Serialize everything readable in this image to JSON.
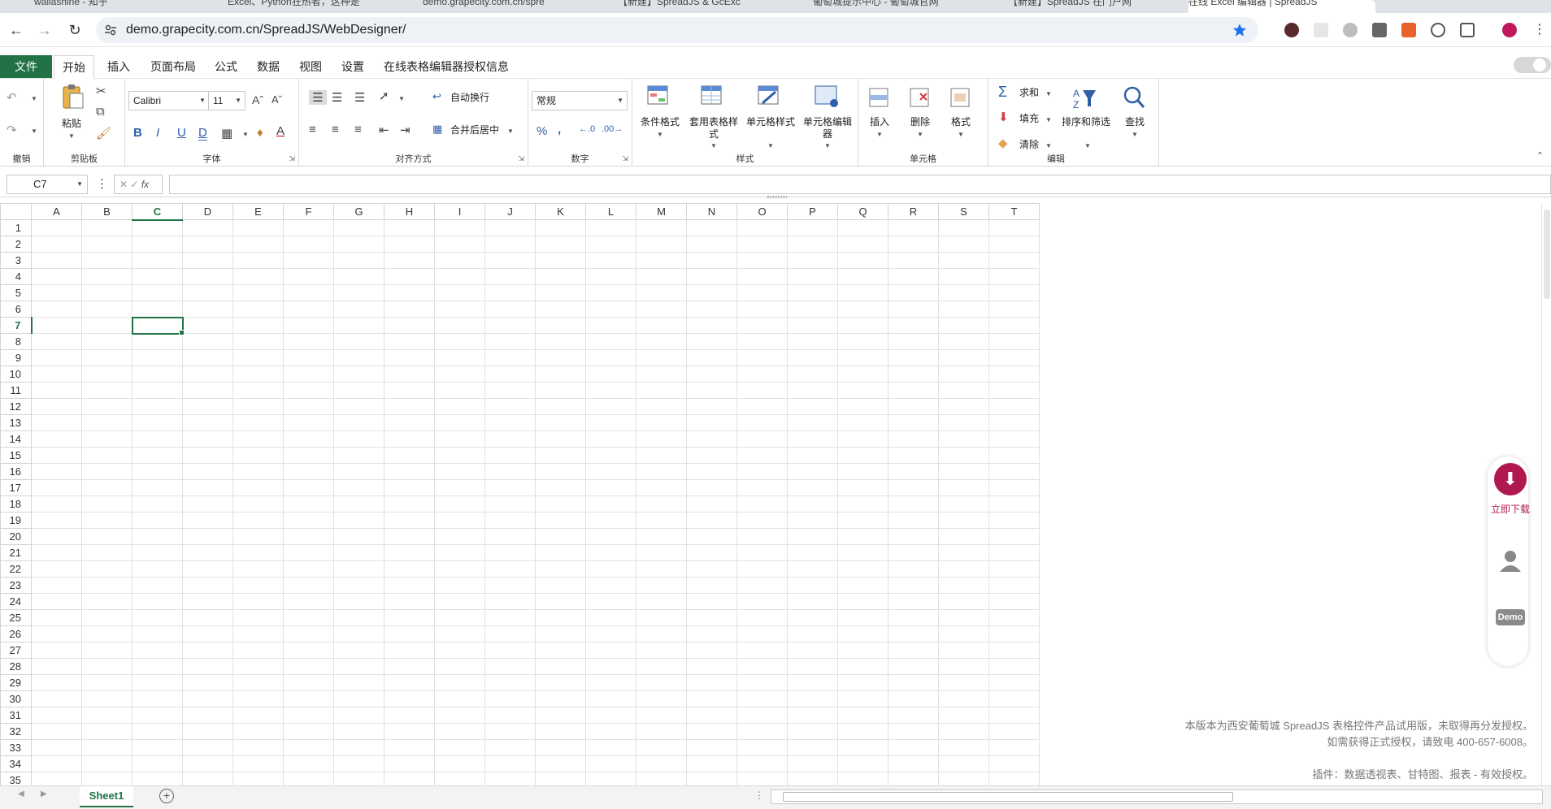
{
  "browser": {
    "tabs": [
      {
        "title": "wallashine - 知乎"
      },
      {
        "title": "Excel、Python狂热者，这种是"
      },
      {
        "title": "demo.grapecity.com.cn/spre"
      },
      {
        "title": "【新建】SpreadJS & GcExc"
      },
      {
        "title": "葡萄城提示中心 - 葡萄城官网"
      },
      {
        "title": "【新建】SpreadJS 在门户网"
      },
      {
        "title": "在线 Excel 编辑器 | SpreadJS"
      }
    ],
    "url": "demo.grapecity.com.cn/SpreadJS/WebDesigner/",
    "accent": "#1a73e8"
  },
  "menu": {
    "file": "文件",
    "tabs": [
      "开始",
      "插入",
      "页面布局",
      "公式",
      "数据",
      "视图",
      "设置",
      "在线表格编辑器授权信息"
    ],
    "active_index": 0
  },
  "ribbon": {
    "groups": {
      "undo": "撤销",
      "clipboard": "剪贴板",
      "font": "字体",
      "alignment": "对齐方式",
      "number": "数字",
      "styles": "样式",
      "cells": "单元格",
      "editing": "编辑"
    },
    "paste": "粘贴",
    "font_name": "Calibri",
    "font_size": "11",
    "wrap_text": "自动换行",
    "merge_center": "合并后居中",
    "number_format": "常规",
    "conditional_format": "条件格式",
    "table_style": "套用表格样式",
    "cell_style": "单元格样式",
    "cell_editor": "单元格编辑器",
    "insert": "插入",
    "delete": "删除",
    "format": "格式",
    "sum": "求和",
    "fill": "填充",
    "clear": "清除",
    "sort_filter": "排序和筛选",
    "find": "查找",
    "bold": "B",
    "italic": "I",
    "underline": "U",
    "double_underline": "D",
    "percent": "%",
    "comma": ","
  },
  "formula_bar": {
    "name_box": "C7",
    "fx": "fx",
    "value": ""
  },
  "sheet": {
    "columns": [
      "A",
      "B",
      "C",
      "D",
      "E",
      "F",
      "G",
      "H",
      "I",
      "J",
      "K",
      "L",
      "M",
      "N",
      "O",
      "P",
      "Q",
      "R",
      "S",
      "T"
    ],
    "row_count": 35,
    "active_cell": "C7",
    "active_col": "C",
    "active_row": 7,
    "accent": "#217346"
  },
  "side_panel": {
    "download": "立即下载",
    "demo": "Demo",
    "accent": "#b01850"
  },
  "notice": {
    "line1": "本版本为西安葡萄城 SpreadJS 表格控件产品试用版，未取得再分发授权。",
    "line2": "如需获得正式授权，请致电 400-657-6008。",
    "line3": "插件：数据透视表、甘特图、报表 - 有效授权。"
  },
  "sheet_tabs": {
    "tabs": [
      "Sheet1"
    ],
    "add": "+"
  }
}
